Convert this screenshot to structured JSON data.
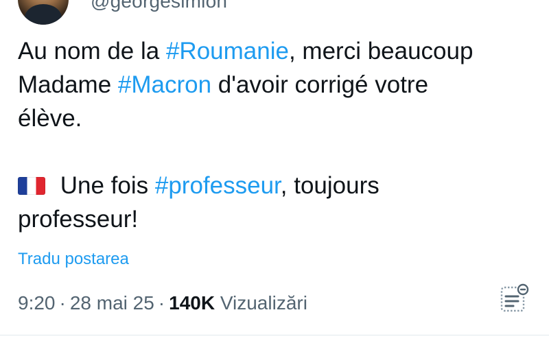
{
  "author": {
    "handle": "@georgesimion"
  },
  "tweet": {
    "p1_line1_a": "Au nom de la ",
    "p1_tag1": "#Roumanie",
    "p1_line1_b": ", merci beaucoup",
    "p1_line2_a": "Madame ",
    "p1_tag2": "#Macron",
    "p1_line2_b": " d'avoir corrigé votre",
    "p1_line3": "élève.",
    "p2_flag_icon": "france-flag-icon",
    "p2_line1_a": " Une fois ",
    "p2_tag": "#professeur",
    "p2_line1_b": ", toujours",
    "p2_line2": "professeur!"
  },
  "translate_label": "Tradu postarea",
  "meta": {
    "time": "9:20",
    "date": "28 mai 25",
    "views_count": "140K",
    "views_label": "Vizualizări",
    "separator": "·"
  },
  "icons": {
    "avatar": "profile-avatar",
    "analytics": "analytics-icon"
  },
  "colors": {
    "link": "#1d9bf0",
    "text": "#0f1419",
    "secondary": "#536471"
  }
}
